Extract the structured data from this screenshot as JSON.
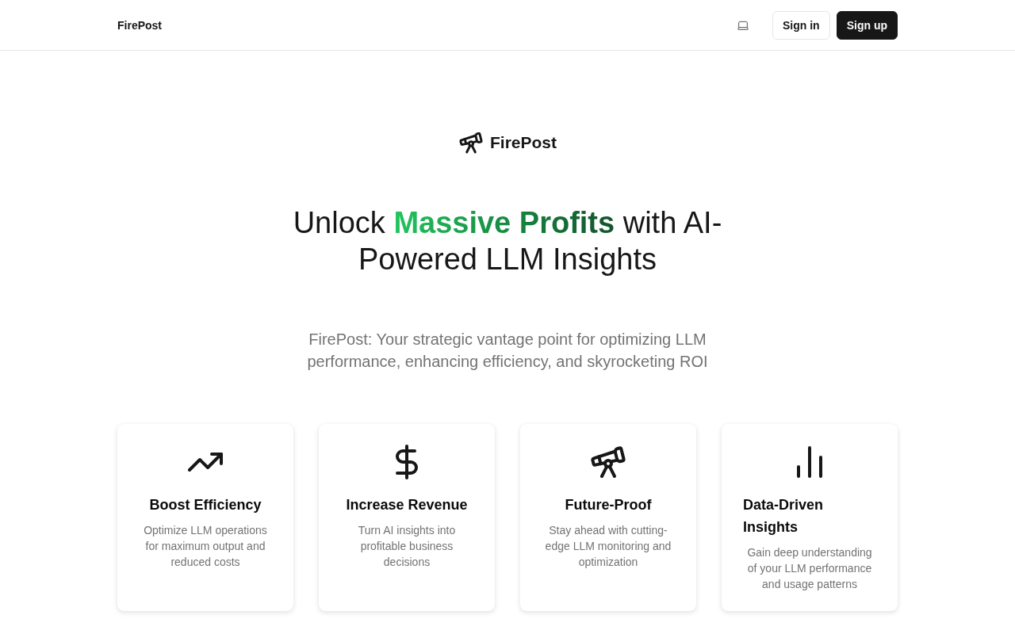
{
  "nav": {
    "brand": "FirePost",
    "buttons": [
      {
        "label": "Sign in",
        "kind": "outline"
      },
      {
        "label": "Sign up",
        "kind": "primary"
      }
    ]
  },
  "hero": {
    "brand": "FirePost",
    "heading": "Unlock **Massive Profits** with AI-Powered LLM Insights",
    "subtitle": "FirePost: Your strategic vantage point for optimizing LLM performance, enhancing efficiency, and skyrocketing ROI"
  },
  "features": [
    {
      "title": "Boost Efficiency",
      "description": "Optimize LLM operations for maximum output and reduced costs"
    },
    {
      "title": "Increase Revenue",
      "description": "Turn AI insights into profitable business decisions"
    },
    {
      "title": "Future-Proof",
      "description": "Stay ahead with cutting-edge LLM monitoring and optimization"
    },
    {
      "title": "Data-Driven Insights",
      "description": "Gain deep understanding of your LLM performance and usage patterns"
    }
  ]
}
